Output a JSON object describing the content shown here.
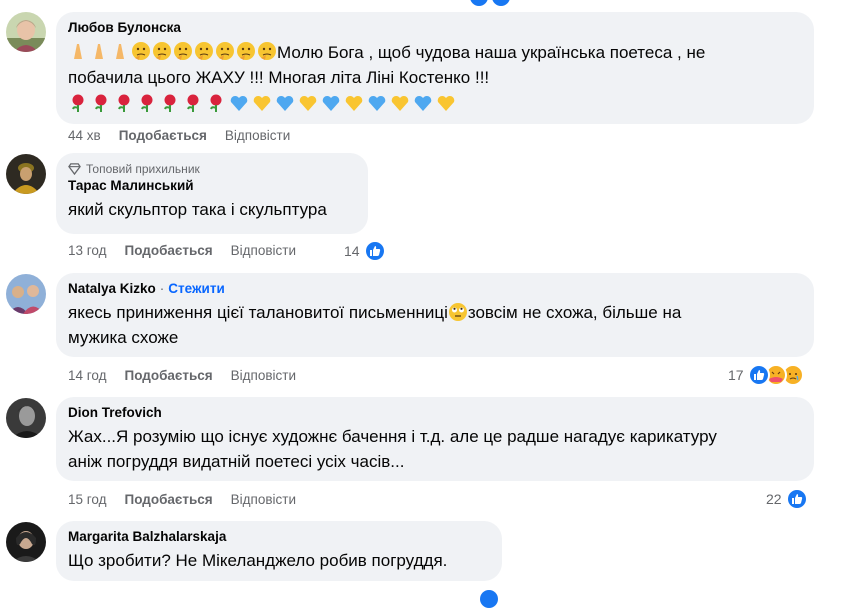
{
  "colors": {
    "bubble": "#f0f2f5",
    "meta_text": "#65676b",
    "follow_link": "#0866ff",
    "like_blue": "#1877f2",
    "emoji_yellow": "#f7b125"
  },
  "comments": [
    {
      "author": "Любов Булонска",
      "text_line1": "Молю Бога , щоб чудова наша українська поетеса , не",
      "text_line2": "побачила цього ЖАХУ !!! Многая літа Ліні Костенко !!!",
      "leading_emojis": [
        "folded-hands",
        "folded-hands",
        "folded-hands",
        "thinking-face",
        "thinking-face",
        "thinking-face",
        "thinking-face",
        "thinking-face",
        "thinking-face",
        "thinking-face"
      ],
      "emoji_row": [
        "rose",
        "rose",
        "rose",
        "rose",
        "rose",
        "rose",
        "rose",
        "blue-heart",
        "yellow-heart",
        "blue-heart",
        "yellow-heart",
        "blue-heart",
        "yellow-heart",
        "blue-heart",
        "yellow-heart",
        "blue-heart",
        "yellow-heart"
      ],
      "time": "44 хв",
      "like": "Подобається",
      "reply": "Відповісти"
    },
    {
      "badge": "Топовий прихильник",
      "author": "Тарас Малинський",
      "text": "який скульптор така і скульптура",
      "time": "13 год",
      "like": "Подобається",
      "reply": "Відповісти",
      "reaction_count": "14",
      "reactions": [
        "like"
      ]
    },
    {
      "author": "Natalya Kizko",
      "follow": "Стежити",
      "text_line1_a": "якесь приниження цієї талановитої письменниці",
      "text_line1_b": "зовсім не схожа, більше на",
      "text_line2": "мужика схоже",
      "inline_emoji": "rolling-eyes-face",
      "time": "14 год",
      "like": "Подобається",
      "reply": "Відповісти",
      "reaction_count": "17",
      "reactions": [
        "like",
        "smiling-face-with-hearts",
        "sad-face"
      ]
    },
    {
      "author": "Dion Trefovich",
      "text_line1": "Жах...Я розумію що існує художнє бачення і т.д. але це радше нагадує карикатуру",
      "text_line2": "аніж погруддя видатній поетесі усіх часів...",
      "time": "15 год",
      "like": "Подобається",
      "reply": "Відповісти",
      "reaction_count": "22",
      "reactions": [
        "like"
      ]
    },
    {
      "author": "Margarita Balzhalarskaja",
      "text": "Що зробити? Не Мікеланджело робив погруддя."
    }
  ]
}
